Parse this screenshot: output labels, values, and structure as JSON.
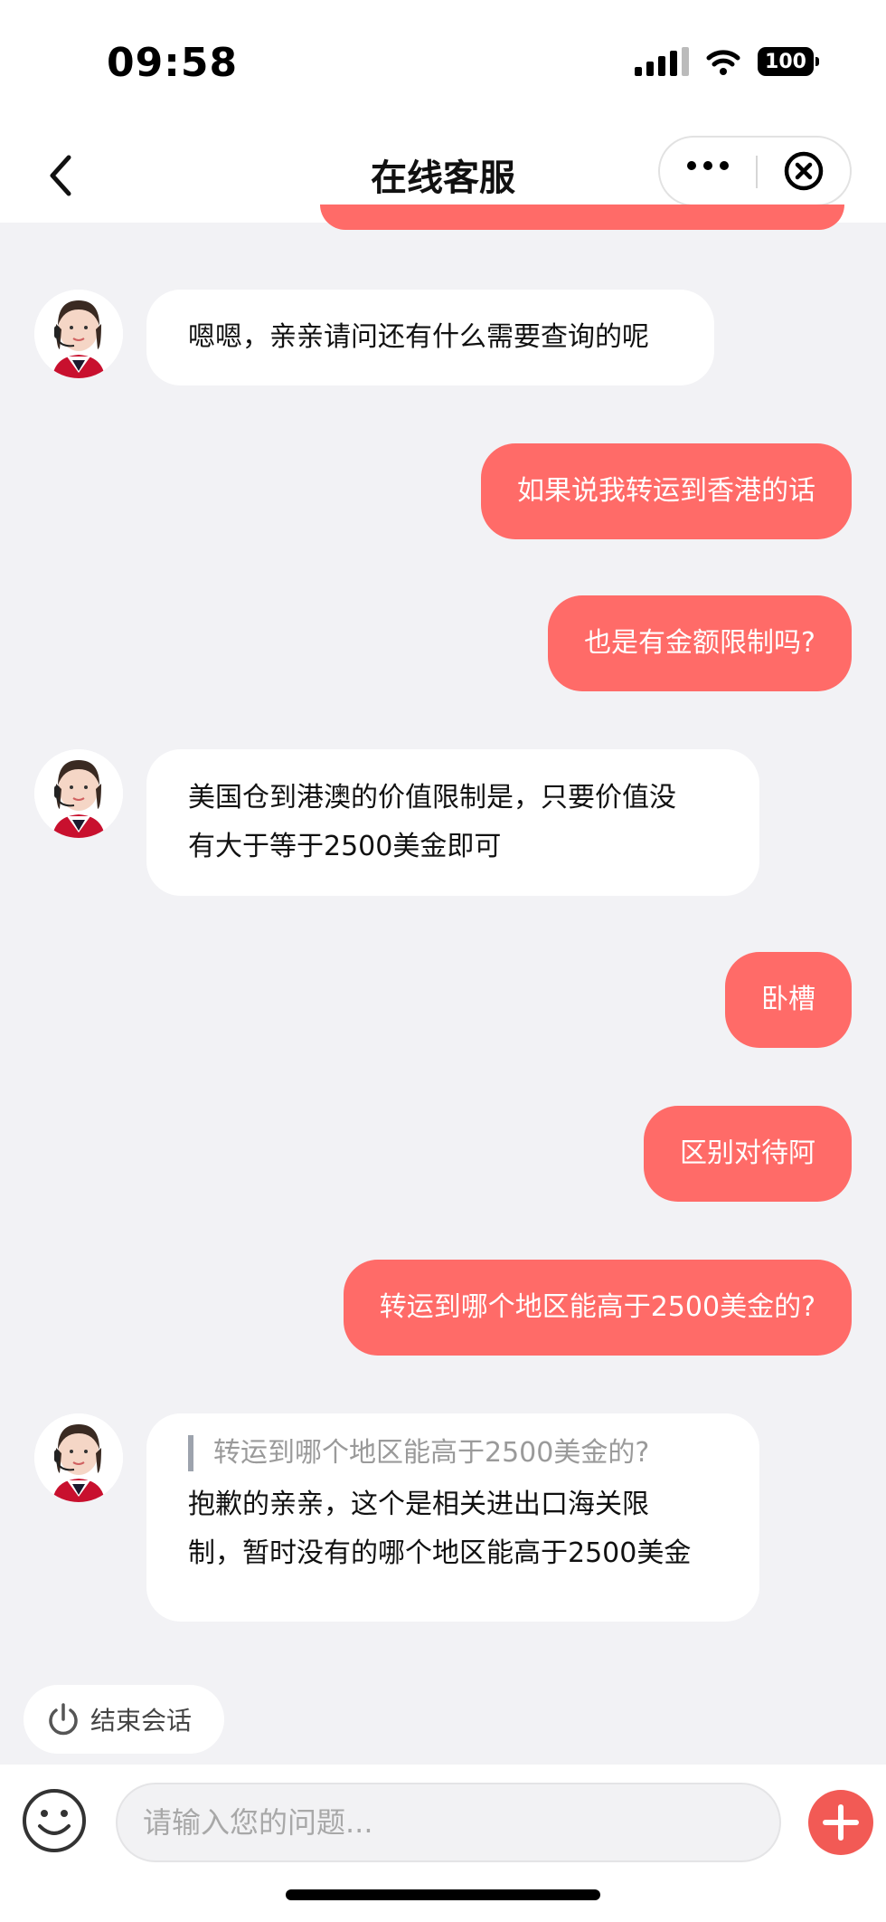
{
  "status_bar": {
    "time": "09:58",
    "battery": "100"
  },
  "nav": {
    "title": "在线客服"
  },
  "messages": [
    {
      "from": "agent",
      "text": "嗯嗯，亲亲请问还有什么需要查询的呢"
    },
    {
      "from": "user",
      "text": "如果说我转运到香港的话"
    },
    {
      "from": "user",
      "text": "也是有金额限制吗?"
    },
    {
      "from": "agent",
      "line1": "美国仓到港澳的价值限制是，只要价值没",
      "line2": "有大于等于2500美金即可"
    },
    {
      "from": "user",
      "text": "卧槽"
    },
    {
      "from": "user",
      "text": "区别对待阿"
    },
    {
      "from": "user",
      "text": "转运到哪个地区能高于2500美金的?"
    },
    {
      "from": "agent",
      "quote": "转运到哪个地区能高于2500美金的?",
      "line1": "抱歉的亲亲，这个是相关进出口海关限",
      "line2": "制，暂时没有的哪个地区能高于2500美金"
    }
  ],
  "end_session": {
    "label": "结束会话"
  },
  "input": {
    "placeholder": "请输入您的问题..."
  },
  "colors": {
    "user_bubble": "#ff6b68",
    "background": "#f2f2f5"
  }
}
